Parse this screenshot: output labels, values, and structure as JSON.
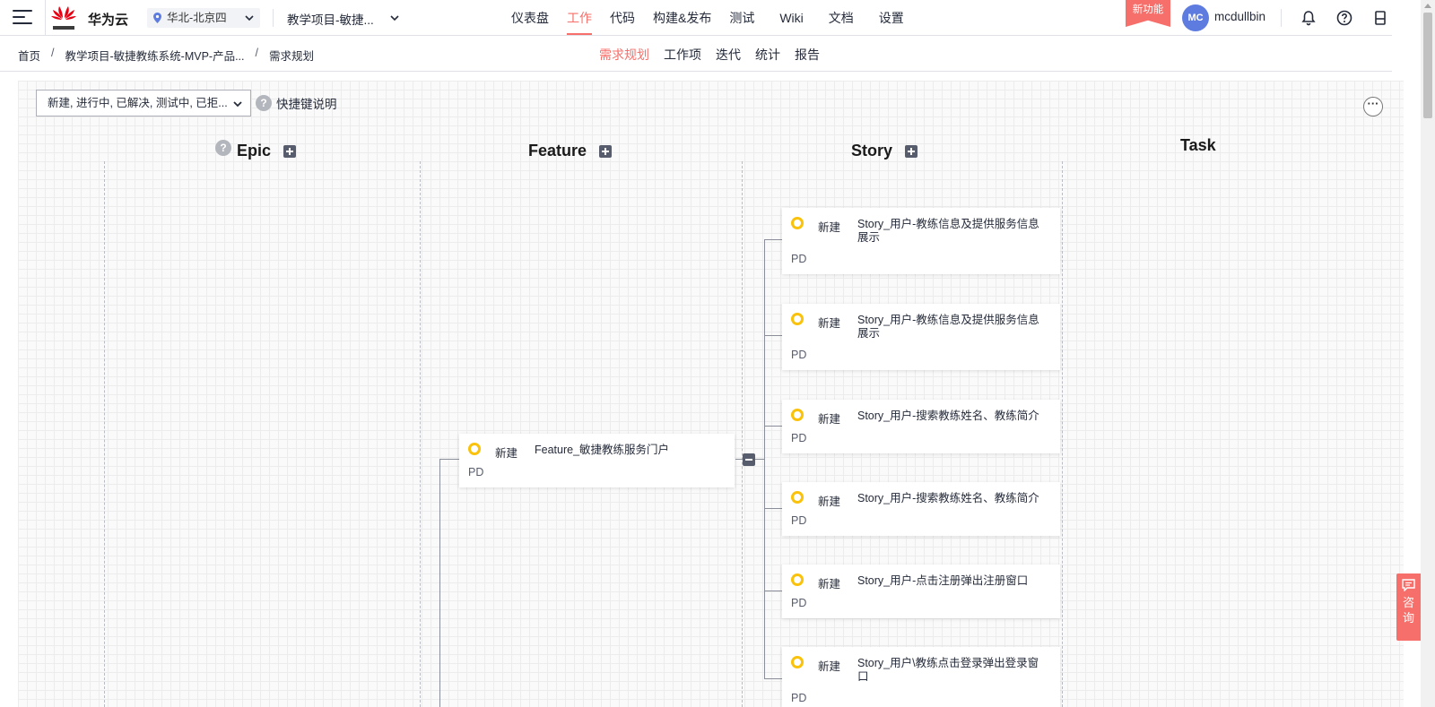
{
  "header": {
    "brand": "华为云",
    "region": "华北-北京四",
    "project": "教学项目-敏捷...",
    "nav": [
      {
        "label": "仪表盘",
        "active": false
      },
      {
        "label": "工作",
        "active": true
      },
      {
        "label": "代码",
        "active": false
      },
      {
        "label": "构建&发布",
        "active": false
      },
      {
        "label": "测试",
        "active": false
      },
      {
        "label": "Wiki",
        "active": false
      },
      {
        "label": "文档",
        "active": false
      },
      {
        "label": "设置",
        "active": false
      }
    ],
    "new_feature_badge": "新功能",
    "avatar_initials": "MC",
    "username": "mcdullbin",
    "icons": [
      "bell-icon",
      "help-icon",
      "device-icon"
    ]
  },
  "subbar": {
    "breadcrumb": [
      "首页",
      "教学项目-敏捷教练系统-MVP-产品...",
      "需求规划"
    ],
    "breadcrumb_separator": "/",
    "tabs": [
      {
        "label": "需求规划",
        "active": true
      },
      {
        "label": "工作项",
        "active": false
      },
      {
        "label": "迭代",
        "active": false
      },
      {
        "label": "统计",
        "active": false
      },
      {
        "label": "报告",
        "active": false
      }
    ]
  },
  "toolbar": {
    "status_filter": "新建, 进行中, 已解决, 测试中, 已拒...",
    "shortcut_label": "快捷键说明",
    "help_glyph": "?",
    "more_glyph": "···"
  },
  "columns": {
    "epic": "Epic",
    "feature": "Feature",
    "story": "Story",
    "task": "Task"
  },
  "feature_card": {
    "status": "新建",
    "title": "Feature_敏捷教练服务门户",
    "owner": "PD"
  },
  "story_cards": [
    {
      "status": "新建",
      "title": "Story_用户-教练信息及提供服务信息展示",
      "owner": "PD"
    },
    {
      "status": "新建",
      "title": "Story_用户-教练信息及提供服务信息展示",
      "owner": "PD"
    },
    {
      "status": "新建",
      "title": "Story_用户-搜索教练姓名、教练简介",
      "owner": "PD"
    },
    {
      "status": "新建",
      "title": "Story_用户-搜索教练姓名、教练简介",
      "owner": "PD"
    },
    {
      "status": "新建",
      "title": "Story_用户-点击注册弹出注册窗口",
      "owner": "PD"
    },
    {
      "status": "新建",
      "title": "Story_用户\\教练点击登录弹出登录窗口",
      "owner": "PD"
    }
  ],
  "consult": {
    "line1": "咨",
    "line2": "询"
  },
  "colors": {
    "accent": "#f66f6a",
    "status_ring": "#fac20a",
    "avatar": "#5e7ce0"
  }
}
